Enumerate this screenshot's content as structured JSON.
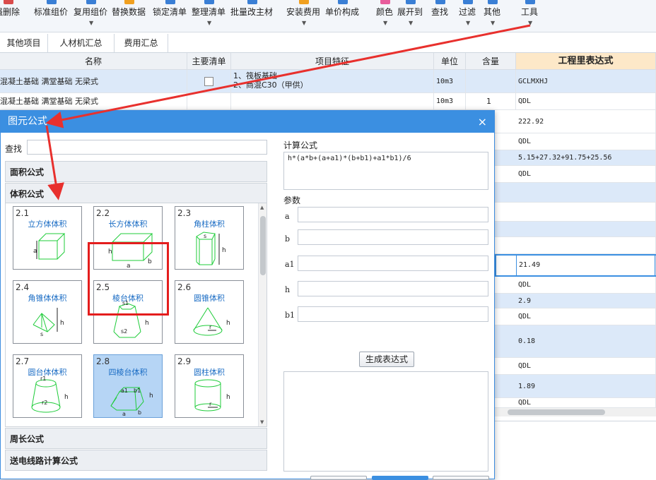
{
  "toolbar": {
    "items": [
      {
        "label": "强删除",
        "icon": "delete-icon"
      },
      {
        "label": "标准组价",
        "icon": "standard-price-icon"
      },
      {
        "label": "复用组价",
        "icon": "reuse-price-icon"
      },
      {
        "label": "替换数据",
        "icon": "replace-data-icon"
      },
      {
        "label": "锁定清单",
        "icon": "lock-list-icon"
      },
      {
        "label": "整理清单",
        "icon": "organize-list-icon"
      },
      {
        "label": "批量改主材",
        "icon": "batch-material-icon"
      },
      {
        "label": "安装费用",
        "icon": "install-fee-icon"
      },
      {
        "label": "单价构成",
        "icon": "unit-price-icon"
      },
      {
        "label": "颜色",
        "icon": "color-icon"
      },
      {
        "label": "展开到",
        "icon": "expand-icon"
      },
      {
        "label": "查找",
        "icon": "search-icon"
      },
      {
        "label": "过滤",
        "icon": "filter-icon"
      },
      {
        "label": "其他",
        "icon": "other-icon"
      },
      {
        "label": "工具",
        "icon": "tools-icon"
      }
    ]
  },
  "tabs": [
    "其他项目",
    "人材机汇总",
    "费用汇总"
  ],
  "grid": {
    "headers": [
      "名称",
      "主要清单",
      "项目特征",
      "单位",
      "含量",
      "工程里表达式"
    ],
    "rows": [
      {
        "name": "混凝土基础 满堂基础 无梁式",
        "feature1": "1、筏板基础",
        "feature2": "2、商混C30（甲供）",
        "unit": "10m3",
        "qty": "",
        "expr": "GCLMXHJ"
      },
      {
        "name": "混凝土基础 满堂基础 无梁式",
        "feature1": "",
        "feature2": "",
        "unit": "10m3",
        "qty": "1",
        "expr": "QDL"
      },
      {
        "expr": "222.92"
      },
      {
        "expr": "QDL"
      },
      {
        "expr": "5.15+27.32+91.75+25.56"
      },
      {
        "expr": "QDL"
      },
      {
        "expr": ""
      },
      {
        "expr": ""
      },
      {
        "expr": ""
      },
      {
        "expr": ""
      },
      {
        "expr": "21.49"
      },
      {
        "expr": "QDL"
      },
      {
        "expr": "2.9"
      },
      {
        "expr": "QDL"
      },
      {
        "expr": "0.18"
      },
      {
        "expr": "QDL"
      },
      {
        "expr": "1.89"
      },
      {
        "expr": "QDL"
      }
    ]
  },
  "dialog": {
    "title": "图元公式",
    "close": "×",
    "search_label": "查找",
    "search_value": "",
    "categories": [
      "面积公式",
      "体积公式",
      "周长公式",
      "送电线路计算公式"
    ],
    "cards": [
      {
        "num": "2.1",
        "title": "立方体体积"
      },
      {
        "num": "2.2",
        "title": "长方体体积"
      },
      {
        "num": "2.3",
        "title": "角柱体积"
      },
      {
        "num": "2.4",
        "title": "角锥体体积"
      },
      {
        "num": "2.5",
        "title": "棱台体积"
      },
      {
        "num": "2.6",
        "title": "圆锥体积"
      },
      {
        "num": "2.7",
        "title": "圆台体体积"
      },
      {
        "num": "2.8",
        "title": "四棱台体积"
      },
      {
        "num": "2.9",
        "title": "圆柱体积"
      }
    ],
    "formula_label": "计算公式",
    "formula_value": "h*(a*b+(a+a1)*(b+b1)+a1*b1)/6",
    "params_label": "参数",
    "params": [
      "a",
      "b",
      "a1",
      "h",
      "b1"
    ],
    "generate_button": "生成表达式",
    "output_value": "",
    "selected_card": "2.8"
  }
}
